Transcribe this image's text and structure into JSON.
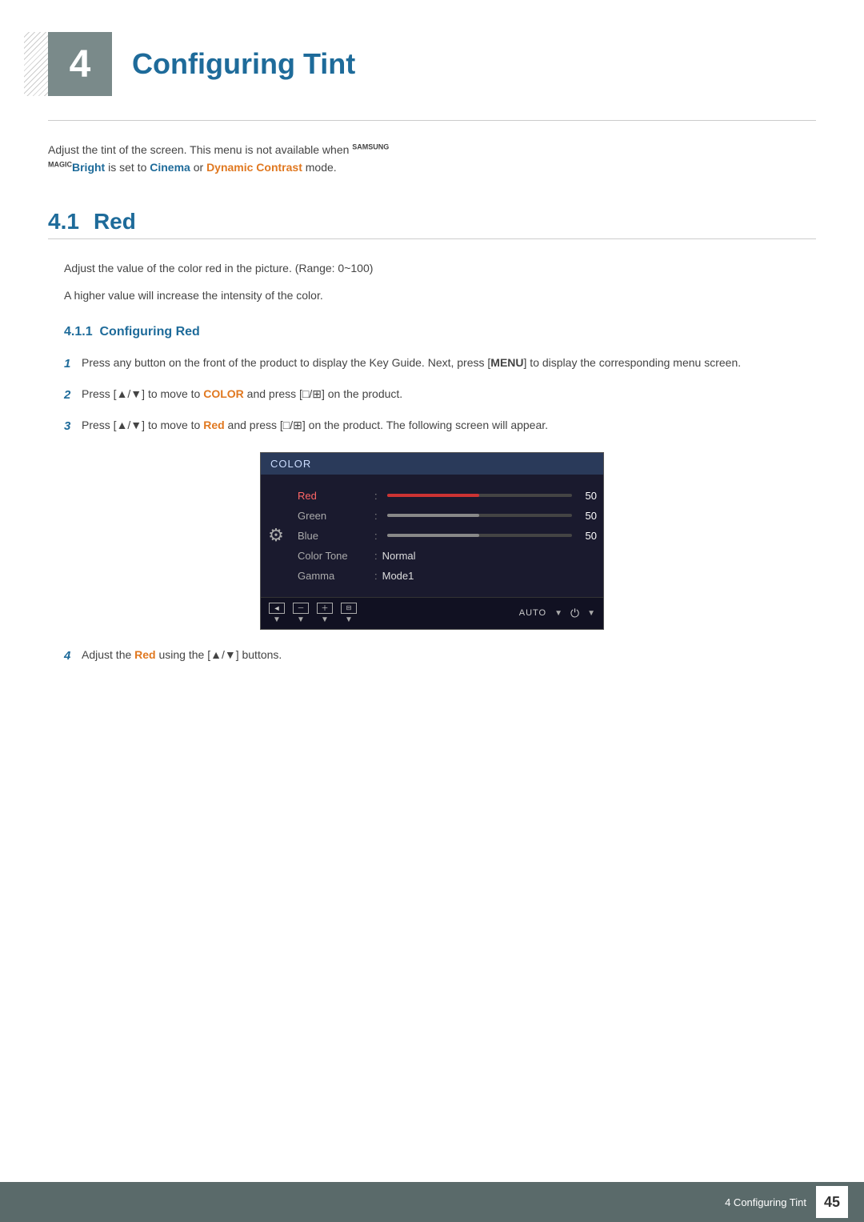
{
  "chapter": {
    "number": "4",
    "title": "Configuring Tint",
    "intro": "Adjust the tint of the screen. This menu is not available when",
    "brand_prefix": "SAMSUNG",
    "brand_suffix": "MAGIC",
    "bright_text": "Bright",
    "middle_text": " is set to ",
    "cinema_text": "Cinema",
    "or_text": " or ",
    "dynamic_text": "Dynamic Contrast",
    "mode_text": " mode."
  },
  "section_41": {
    "number": "4.1",
    "title": "Red",
    "para1": "Adjust the value of the color red in the picture. (Range: 0~100)",
    "para2": "A higher value will increase the intensity of the color.",
    "subsection_411": {
      "number": "4.1.1",
      "title": "Configuring Red",
      "steps": [
        {
          "num": "1",
          "text": "Press any button on the front of the product to display the Key Guide. Next, press [",
          "bold1": "MENU",
          "text2": "] to display the corresponding menu screen."
        },
        {
          "num": "2",
          "text_pre": "Press [▲/▼] to move to ",
          "color_word": "COLOR",
          "text_mid": " and press [",
          "icon_text": "□/⊞",
          "text_post": "] on the product."
        },
        {
          "num": "3",
          "text_pre": "Press [▲/▼] to move to ",
          "red_word": "Red",
          "text_mid": " and press [",
          "icon_text": "□/⊞",
          "text_post": "] on the product. The following screen will appear."
        },
        {
          "num": "4",
          "text_pre": "Adjust the ",
          "red_word": "Red",
          "text_post": " using the [▲/▼] buttons."
        }
      ]
    }
  },
  "color_menu": {
    "title": "COLOR",
    "items": [
      {
        "label": "Red",
        "type": "slider",
        "value": "50",
        "color": "red"
      },
      {
        "label": "Green",
        "type": "slider",
        "value": "50",
        "color": "gray"
      },
      {
        "label": "Blue",
        "type": "slider",
        "value": "50",
        "color": "gray"
      },
      {
        "label": "Color Tone",
        "type": "text",
        "value": "Normal"
      },
      {
        "label": "Gamma",
        "type": "text",
        "value": "Mode1"
      }
    ]
  },
  "footer": {
    "text": "4 Configuring Tint",
    "page_number": "45"
  }
}
